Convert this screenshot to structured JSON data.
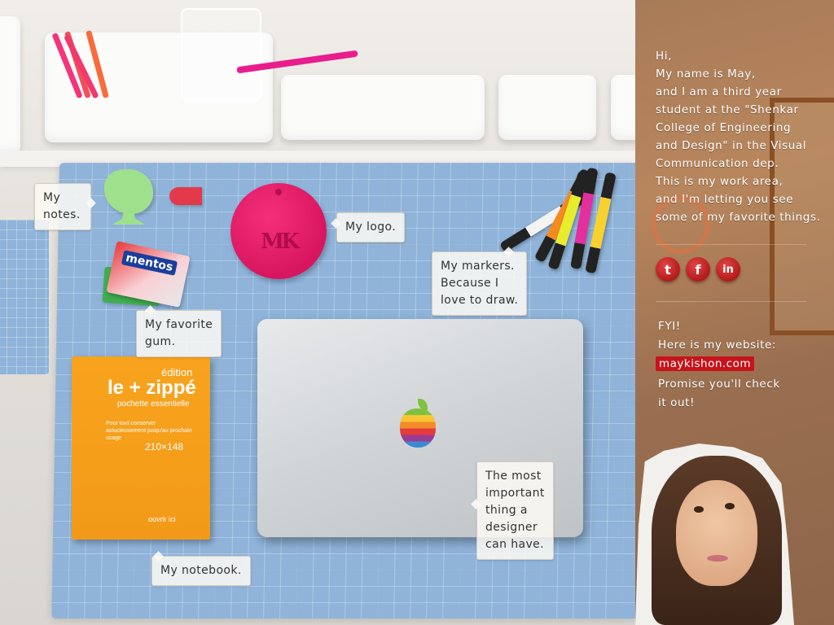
{
  "desk": {
    "callouts": {
      "notes": "My\nnotes.",
      "logo": "My logo.",
      "markers": "My markers.\nBecause I\nlove to draw.",
      "gum": "My favorite\ngum.",
      "notebook": "My notebook.",
      "laptop": "The most\nimportant\nthing a\ndesigner\ncan have."
    },
    "logo_monogram": "MK",
    "gum_brand": "mentos",
    "notebook": {
      "edition": "édition",
      "brand": "le + zippé",
      "subtitle": "pochette essentielle",
      "body": "Pour tout conserver astucieusement jusqu'au prochain usage",
      "size": "210×148",
      "open": "ouvrir ici"
    }
  },
  "panel": {
    "intro": "Hi,\nMy name is May,\nand I am a third year\nstudent at the \"Shenkar\nCollege of Engineering\nand Design\" in the Visual\nCommunication dep.\nThis is my work area,\nand I'm letting you see\nsome of my favorite things.",
    "social": [
      {
        "icon": "twitter-icon",
        "glyph": "t"
      },
      {
        "icon": "facebook-icon",
        "glyph": "f"
      },
      {
        "icon": "linkedin-icon",
        "glyph": "in"
      }
    ],
    "fyi_title": "FYI!",
    "fyi_line": "Here is my website:",
    "website": "maykishon.com",
    "promise": "Promise you'll check\nit out!"
  },
  "colors": {
    "accent_red": "#c6141a",
    "mat_blue": "#8fb3d9",
    "logo_pink": "#d8155f",
    "notebook_orange": "#f29a18"
  }
}
